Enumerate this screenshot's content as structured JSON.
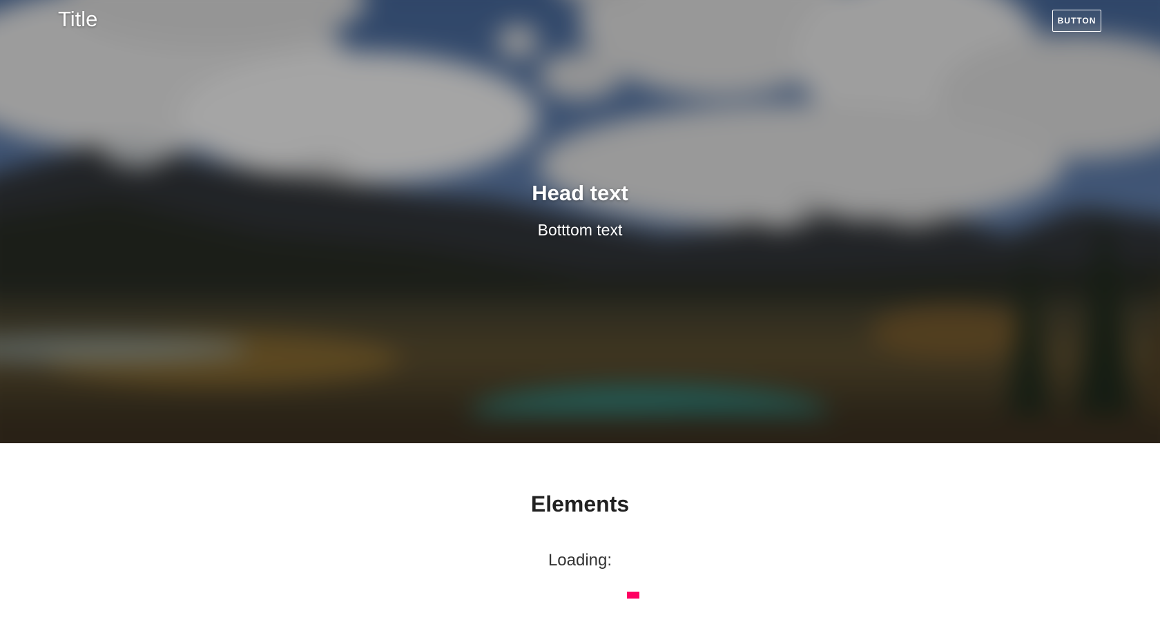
{
  "header": {
    "title": "Title",
    "button_label": "BUTTON"
  },
  "hero": {
    "heading": "Head text",
    "subheading": "Botttom text",
    "background_image": "blurred-mountain-landscape"
  },
  "content": {
    "section_title": "Elements",
    "loading_label": "Loading:",
    "loading_progress": 0.18,
    "loading_color": "#ff0062"
  },
  "colors": {
    "hero_text": "#ffffff",
    "accent": "#ff0062",
    "page_background": "#ffffff",
    "text_dark": "#212121"
  }
}
